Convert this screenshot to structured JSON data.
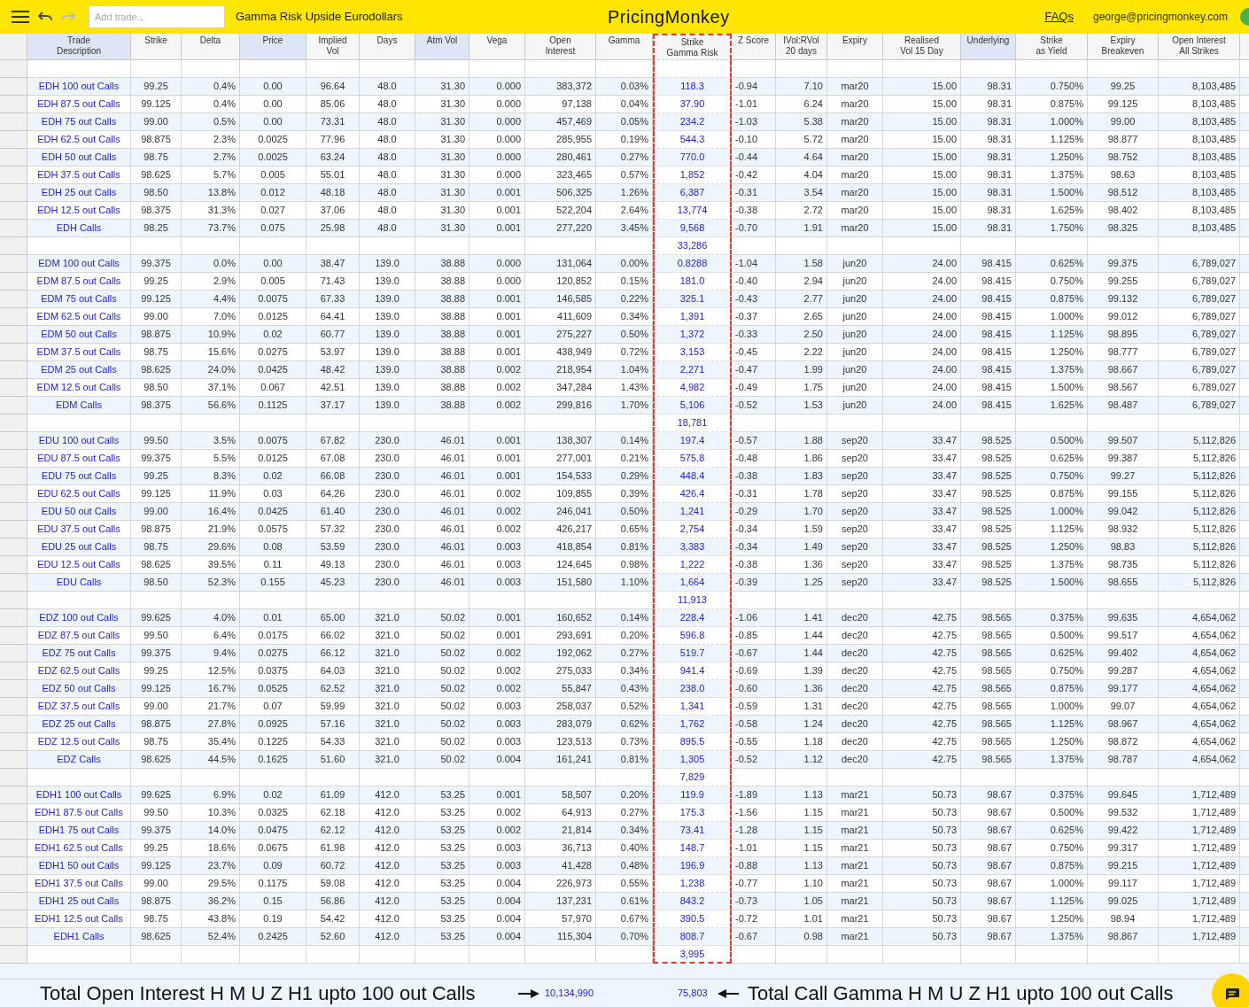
{
  "topbar": {
    "add_trade": {
      "placeholder": "Add trade..."
    },
    "title": "Gamma Risk Upside Eurodollars",
    "logo": "PricingMonkey",
    "faq_link": "FAQs",
    "user_email": "george@pricingmonkey.com",
    "redo_disabled": true
  },
  "table": {
    "columns": [
      {
        "label": "Trade\nDescription",
        "highlighted": true
      },
      {
        "label": "Strike",
        "highlighted": false
      },
      {
        "label": "Delta",
        "highlighted": false
      },
      {
        "label": "Price",
        "highlighted": true
      },
      {
        "label": "Implied\nVol",
        "highlighted": false
      },
      {
        "label": "Days",
        "highlighted": false
      },
      {
        "label": "Atm Vol",
        "highlighted": true
      },
      {
        "label": "Vega",
        "highlighted": false
      },
      {
        "label": "Open\nInterest",
        "highlighted": false
      },
      {
        "label": "Gamma",
        "highlighted": false
      },
      {
        "label": "Strike\nGamma Risk",
        "highlighted": false
      },
      {
        "label": "Z Score",
        "highlighted": false
      },
      {
        "label": "IVol:RVol\n20 days",
        "highlighted": false
      },
      {
        "label": "Expiry",
        "highlighted": false
      },
      {
        "label": "Realised\nVol 15 Day",
        "highlighted": false
      },
      {
        "label": "Underlying",
        "highlighted": true
      },
      {
        "label": "Strike\nas Yield",
        "highlighted": false
      },
      {
        "label": "Expiry\nBreakeven",
        "highlighted": false
      },
      {
        "label": "Open Interest\nAll Strikes",
        "highlighted": false
      }
    ],
    "groups": [
      {
        "rows": [
          [
            "EDH 100 out Calls",
            "99.25",
            "0.4%",
            "0.00",
            "96.64",
            "48.0",
            "31.30",
            "0.000",
            "383,372",
            "0.03%",
            "118.3",
            "-0.94",
            "7.10",
            "mar20",
            "15.00",
            "98.31",
            "0.750%",
            "99.25",
            "8,103,485"
          ],
          [
            "EDH 87.5 out Calls",
            "99.125",
            "0.4%",
            "0.00",
            "85.06",
            "48.0",
            "31.30",
            "0.000",
            "97,138",
            "0.04%",
            "37.90",
            "-1.01",
            "6.24",
            "mar20",
            "15.00",
            "98.31",
            "0.875%",
            "99.125",
            "8,103,485"
          ],
          [
            "EDH 75 out Calls",
            "99.00",
            "0.5%",
            "0.00",
            "73.31",
            "48.0",
            "31.30",
            "0.000",
            "457,469",
            "0.05%",
            "234.2",
            "-1.03",
            "5.38",
            "mar20",
            "15.00",
            "98.31",
            "1.000%",
            "99.00",
            "8,103,485"
          ],
          [
            "EDH 62.5 out Calls",
            "98.875",
            "2.3%",
            "0.0025",
            "77.96",
            "48.0",
            "31.30",
            "0.000",
            "285,955",
            "0.19%",
            "544.3",
            "-0.10",
            "5.72",
            "mar20",
            "15.00",
            "98.31",
            "1.125%",
            "98.877",
            "8,103,485"
          ],
          [
            "EDH 50 out Calls",
            "98.75",
            "2.7%",
            "0.0025",
            "63.24",
            "48.0",
            "31.30",
            "0.000",
            "280,461",
            "0.27%",
            "770.0",
            "-0.44",
            "4.64",
            "mar20",
            "15.00",
            "98.31",
            "1.250%",
            "98.752",
            "8,103,485"
          ],
          [
            "EDH 37.5 out Calls",
            "98.625",
            "5.7%",
            "0.005",
            "55.01",
            "48.0",
            "31.30",
            "0.000",
            "323,465",
            "0.57%",
            "1,852",
            "-0.42",
            "4.04",
            "mar20",
            "15.00",
            "98.31",
            "1.375%",
            "98.63",
            "8,103,485"
          ],
          [
            "EDH 25 out Calls",
            "98.50",
            "13.8%",
            "0.012",
            "48.18",
            "48.0",
            "31.30",
            "0.001",
            "506,325",
            "1.26%",
            "6,387",
            "-0.31",
            "3.54",
            "mar20",
            "15.00",
            "98.31",
            "1.500%",
            "98.512",
            "8,103,485"
          ],
          [
            "EDH 12.5 out Calls",
            "98.375",
            "31.3%",
            "0.027",
            "37.06",
            "48.0",
            "31.30",
            "0.001",
            "522,204",
            "2.64%",
            "13,774",
            "-0.38",
            "2.72",
            "mar20",
            "15.00",
            "98.31",
            "1.625%",
            "98.402",
            "8,103,485"
          ],
          [
            "EDH Calls",
            "98.25",
            "73.7%",
            "0.075",
            "25.98",
            "48.0",
            "31.30",
            "0.001",
            "277,220",
            "3.45%",
            "9,568",
            "-0.70",
            "1.91",
            "mar20",
            "15.00",
            "98.31",
            "1.750%",
            "98.325",
            "8,103,485"
          ]
        ],
        "gamma_total": "33,286"
      },
      {
        "rows": [
          [
            "EDM 100 out Calls",
            "99.375",
            "0.0%",
            "0.00",
            "38.47",
            "139.0",
            "38.88",
            "0.000",
            "131,064",
            "0.00%",
            "0.8288",
            "-1.04",
            "1.58",
            "jun20",
            "24.00",
            "98.415",
            "0.625%",
            "99.375",
            "6,789,027"
          ],
          [
            "EDM 87.5 out Calls",
            "99.25",
            "2.9%",
            "0.005",
            "71.43",
            "139.0",
            "38.88",
            "0.000",
            "120,852",
            "0.15%",
            "181.0",
            "-0.40",
            "2.94",
            "jun20",
            "24.00",
            "98.415",
            "0.750%",
            "99.255",
            "6,789,027"
          ],
          [
            "EDM 75 out Calls",
            "99.125",
            "4.4%",
            "0.0075",
            "67.33",
            "139.0",
            "38.88",
            "0.001",
            "146,585",
            "0.22%",
            "325.1",
            "-0.43",
            "2.77",
            "jun20",
            "24.00",
            "98.415",
            "0.875%",
            "99.132",
            "6,789,027"
          ],
          [
            "EDM 62.5 out Calls",
            "99.00",
            "7.0%",
            "0.0125",
            "64.41",
            "139.0",
            "38.88",
            "0.001",
            "411,609",
            "0.34%",
            "1,391",
            "-0.37",
            "2.65",
            "jun20",
            "24.00",
            "98.415",
            "1.000%",
            "99.012",
            "6,789,027"
          ],
          [
            "EDM 50 out Calls",
            "98.875",
            "10.9%",
            "0.02",
            "60.77",
            "139.0",
            "38.88",
            "0.001",
            "275,227",
            "0.50%",
            "1,372",
            "-0.33",
            "2.50",
            "jun20",
            "24.00",
            "98.415",
            "1.125%",
            "98.895",
            "6,789,027"
          ],
          [
            "EDM 37.5 out Calls",
            "98.75",
            "15.6%",
            "0.0275",
            "53.97",
            "139.0",
            "38.88",
            "0.001",
            "438,949",
            "0.72%",
            "3,153",
            "-0.45",
            "2.22",
            "jun20",
            "24.00",
            "98.415",
            "1.250%",
            "98.777",
            "6,789,027"
          ],
          [
            "EDM 25 out Calls",
            "98.625",
            "24.0%",
            "0.0425",
            "48.42",
            "139.0",
            "38.88",
            "0.002",
            "218,954",
            "1.04%",
            "2,271",
            "-0.47",
            "1.99",
            "jun20",
            "24.00",
            "98.415",
            "1.375%",
            "98.667",
            "6,789,027"
          ],
          [
            "EDM 12.5 out Calls",
            "98.50",
            "37.1%",
            "0.067",
            "42.51",
            "139.0",
            "38.88",
            "0.002",
            "347,284",
            "1.43%",
            "4,982",
            "-0.49",
            "1.75",
            "jun20",
            "24.00",
            "98.415",
            "1.500%",
            "98.567",
            "6,789,027"
          ],
          [
            "EDM Calls",
            "98.375",
            "56.6%",
            "0.1125",
            "37.17",
            "139.0",
            "38.88",
            "0.002",
            "299,816",
            "1.70%",
            "5,106",
            "-0.52",
            "1.53",
            "jun20",
            "24.00",
            "98.415",
            "1.625%",
            "98.487",
            "6,789,027"
          ]
        ],
        "gamma_total": "18,781"
      },
      {
        "rows": [
          [
            "EDU 100 out Calls",
            "99.50",
            "3.5%",
            "0.0075",
            "67.82",
            "230.0",
            "46.01",
            "0.001",
            "138,307",
            "0.14%",
            "197.4",
            "-0.57",
            "1.88",
            "sep20",
            "33.47",
            "98.525",
            "0.500%",
            "99.507",
            "5,112,826"
          ],
          [
            "EDU 87.5 out Calls",
            "99.375",
            "5.5%",
            "0.0125",
            "67.08",
            "230.0",
            "46.01",
            "0.001",
            "277,001",
            "0.21%",
            "575.8",
            "-0.48",
            "1.86",
            "sep20",
            "33.47",
            "98.525",
            "0.625%",
            "99.387",
            "5,112,826"
          ],
          [
            "EDU 75 out Calls",
            "99.25",
            "8.3%",
            "0.02",
            "66.08",
            "230.0",
            "46.01",
            "0.001",
            "154,533",
            "0.29%",
            "448.4",
            "-0.38",
            "1.83",
            "sep20",
            "33.47",
            "98.525",
            "0.750%",
            "99.27",
            "5,112,826"
          ],
          [
            "EDU 62.5 out Calls",
            "99.125",
            "11.9%",
            "0.03",
            "64.26",
            "230.0",
            "46.01",
            "0.002",
            "109,855",
            "0.39%",
            "426.4",
            "-0.31",
            "1.78",
            "sep20",
            "33.47",
            "98.525",
            "0.875%",
            "99.155",
            "5,112,826"
          ],
          [
            "EDU 50 out Calls",
            "99.00",
            "16.4%",
            "0.0425",
            "61.40",
            "230.0",
            "46.01",
            "0.002",
            "246,041",
            "0.50%",
            "1,241",
            "-0.29",
            "1.70",
            "sep20",
            "33.47",
            "98.525",
            "1.000%",
            "99.042",
            "5,112,826"
          ],
          [
            "EDU 37.5 out Calls",
            "98.875",
            "21.9%",
            "0.0575",
            "57.32",
            "230.0",
            "46.01",
            "0.002",
            "426,217",
            "0.65%",
            "2,754",
            "-0.34",
            "1.59",
            "sep20",
            "33.47",
            "98.525",
            "1.125%",
            "98.932",
            "5,112,826"
          ],
          [
            "EDU 25 out Calls",
            "98.75",
            "29.6%",
            "0.08",
            "53.59",
            "230.0",
            "46.01",
            "0.003",
            "418,854",
            "0.81%",
            "3,383",
            "-0.34",
            "1.49",
            "sep20",
            "33.47",
            "98.525",
            "1.250%",
            "98.83",
            "5,112,826"
          ],
          [
            "EDU 12.5 out Calls",
            "98.625",
            "39.5%",
            "0.11",
            "49.13",
            "230.0",
            "46.01",
            "0.003",
            "124,645",
            "0.98%",
            "1,222",
            "-0.38",
            "1.36",
            "sep20",
            "33.47",
            "98.525",
            "1.375%",
            "98.735",
            "5,112,826"
          ],
          [
            "EDU Calls",
            "98.50",
            "52.3%",
            "0.155",
            "45.23",
            "230.0",
            "46.01",
            "0.003",
            "151,580",
            "1.10%",
            "1,664",
            "-0.39",
            "1.25",
            "sep20",
            "33.47",
            "98.525",
            "1.500%",
            "98.655",
            "5,112,826"
          ]
        ],
        "gamma_total": "11,913"
      },
      {
        "rows": [
          [
            "EDZ 100 out Calls",
            "99.625",
            "4.0%",
            "0.01",
            "65.00",
            "321.0",
            "50.02",
            "0.001",
            "160,652",
            "0.14%",
            "228.4",
            "-1.06",
            "1.41",
            "dec20",
            "42.75",
            "98.565",
            "0.375%",
            "99.635",
            "4,654,062"
          ],
          [
            "EDZ 87.5 out Calls",
            "99.50",
            "6.4%",
            "0.0175",
            "66.02",
            "321.0",
            "50.02",
            "0.001",
            "293,691",
            "0.20%",
            "596.8",
            "-0.85",
            "1.44",
            "dec20",
            "42.75",
            "98.565",
            "0.500%",
            "99.517",
            "4,654,062"
          ],
          [
            "EDZ 75 out Calls",
            "99.375",
            "9.4%",
            "0.0275",
            "66.12",
            "321.0",
            "50.02",
            "0.002",
            "192,062",
            "0.27%",
            "519.7",
            "-0.67",
            "1.44",
            "dec20",
            "42.75",
            "98.565",
            "0.625%",
            "99.402",
            "4,654,062"
          ],
          [
            "EDZ 62.5 out Calls",
            "99.25",
            "12.5%",
            "0.0375",
            "64.03",
            "321.0",
            "50.02",
            "0.002",
            "275,033",
            "0.34%",
            "941.4",
            "-0.69",
            "1.39",
            "dec20",
            "42.75",
            "98.565",
            "0.750%",
            "99.287",
            "4,654,062"
          ],
          [
            "EDZ 50 out Calls",
            "99.125",
            "16.7%",
            "0.0525",
            "62.52",
            "321.0",
            "50.02",
            "0.002",
            "55,847",
            "0.43%",
            "238.0",
            "-0.60",
            "1.36",
            "dec20",
            "42.75",
            "98.565",
            "0.875%",
            "99.177",
            "4,654,062"
          ],
          [
            "EDZ 37.5 out Calls",
            "99.00",
            "21.7%",
            "0.07",
            "59.99",
            "321.0",
            "50.02",
            "0.003",
            "258,037",
            "0.52%",
            "1,341",
            "-0.59",
            "1.31",
            "dec20",
            "42.75",
            "98.565",
            "1.000%",
            "99.07",
            "4,654,062"
          ],
          [
            "EDZ 25 out Calls",
            "98.875",
            "27.8%",
            "0.0925",
            "57.16",
            "321.0",
            "50.02",
            "0.003",
            "283,079",
            "0.62%",
            "1,762",
            "-0.58",
            "1.24",
            "dec20",
            "42.75",
            "98.565",
            "1.125%",
            "98.967",
            "4,654,062"
          ],
          [
            "EDZ 12.5 out Calls",
            "98.75",
            "35.4%",
            "0.1225",
            "54.33",
            "321.0",
            "50.02",
            "0.003",
            "123,513",
            "0.73%",
            "895.5",
            "-0.55",
            "1.18",
            "dec20",
            "42.75",
            "98.565",
            "1.250%",
            "98.872",
            "4,654,062"
          ],
          [
            "EDZ Calls",
            "98.625",
            "44.5%",
            "0.1625",
            "51.60",
            "321.0",
            "50.02",
            "0.004",
            "161,241",
            "0.81%",
            "1,305",
            "-0.52",
            "1.12",
            "dec20",
            "42.75",
            "98.565",
            "1.375%",
            "98.787",
            "4,654,062"
          ]
        ],
        "gamma_total": "7,829"
      },
      {
        "rows": [
          [
            "EDH1 100 out Calls",
            "99.625",
            "6.9%",
            "0.02",
            "61.09",
            "412.0",
            "53.25",
            "0.001",
            "58,507",
            "0.20%",
            "119.9",
            "-1.89",
            "1.13",
            "mar21",
            "50.73",
            "98.67",
            "0.375%",
            "99.645",
            "1,712,489"
          ],
          [
            "EDH1 87.5 out Calls",
            "99.50",
            "10.3%",
            "0.0325",
            "62.18",
            "412.0",
            "53.25",
            "0.002",
            "64,913",
            "0.27%",
            "175.3",
            "-1.56",
            "1.15",
            "mar21",
            "50.73",
            "98.67",
            "0.500%",
            "99.532",
            "1,712,489"
          ],
          [
            "EDH1 75 out Calls",
            "99.375",
            "14.0%",
            "0.0475",
            "62.12",
            "412.0",
            "53.25",
            "0.002",
            "21,814",
            "0.34%",
            "73.41",
            "-1.28",
            "1.15",
            "mar21",
            "50.73",
            "98.67",
            "0.625%",
            "99.422",
            "1,712,489"
          ],
          [
            "EDH1 62.5 out Calls",
            "99.25",
            "18.6%",
            "0.0675",
            "61.98",
            "412.0",
            "53.25",
            "0.003",
            "36,713",
            "0.40%",
            "148.7",
            "-1.01",
            "1.15",
            "mar21",
            "50.73",
            "98.67",
            "0.750%",
            "99.317",
            "1,712,489"
          ],
          [
            "EDH1 50 out Calls",
            "99.125",
            "23.7%",
            "0.09",
            "60.72",
            "412.0",
            "53.25",
            "0.003",
            "41,428",
            "0.48%",
            "196.9",
            "-0.88",
            "1.13",
            "mar21",
            "50.73",
            "98.67",
            "0.875%",
            "99.215",
            "1,712,489"
          ],
          [
            "EDH1 37.5 out Calls",
            "99.00",
            "29.5%",
            "0.1175",
            "59.08",
            "412.0",
            "53.25",
            "0.004",
            "226,973",
            "0.55%",
            "1,238",
            "-0.77",
            "1.10",
            "mar21",
            "50.73",
            "98.67",
            "1.000%",
            "99.117",
            "1,712,489"
          ],
          [
            "EDH1 25 out Calls",
            "98.875",
            "36.2%",
            "0.15",
            "56.86",
            "412.0",
            "53.25",
            "0.004",
            "137,231",
            "0.61%",
            "843.2",
            "-0.73",
            "1.05",
            "mar21",
            "50.73",
            "98.67",
            "1.125%",
            "99.025",
            "1,712,489"
          ],
          [
            "EDH1 12.5 out Calls",
            "98.75",
            "43.8%",
            "0.19",
            "54.42",
            "412.0",
            "53.25",
            "0.004",
            "57,970",
            "0.67%",
            "390.5",
            "-0.72",
            "1.01",
            "mar21",
            "50.73",
            "98.67",
            "1.250%",
            "98.94",
            "1,712,489"
          ],
          [
            "EDH1 Calls",
            "98.625",
            "52.4%",
            "0.2425",
            "52.60",
            "412.0",
            "53.25",
            "0.004",
            "115,304",
            "0.70%",
            "808.7",
            "-0.67",
            "0.98",
            "mar21",
            "50.73",
            "98.67",
            "1.375%",
            "98.867",
            "1,712,489"
          ]
        ],
        "gamma_total": "3,995"
      }
    ]
  },
  "footer": {
    "open_interest_label": "Total Open Interest H M U Z H1 upto 100 out Calls",
    "open_interest_total": "10,134,990",
    "gamma_total": "75,803",
    "gamma_label": "Total Call Gamma H M U Z H1 upto 100 out Calls"
  }
}
